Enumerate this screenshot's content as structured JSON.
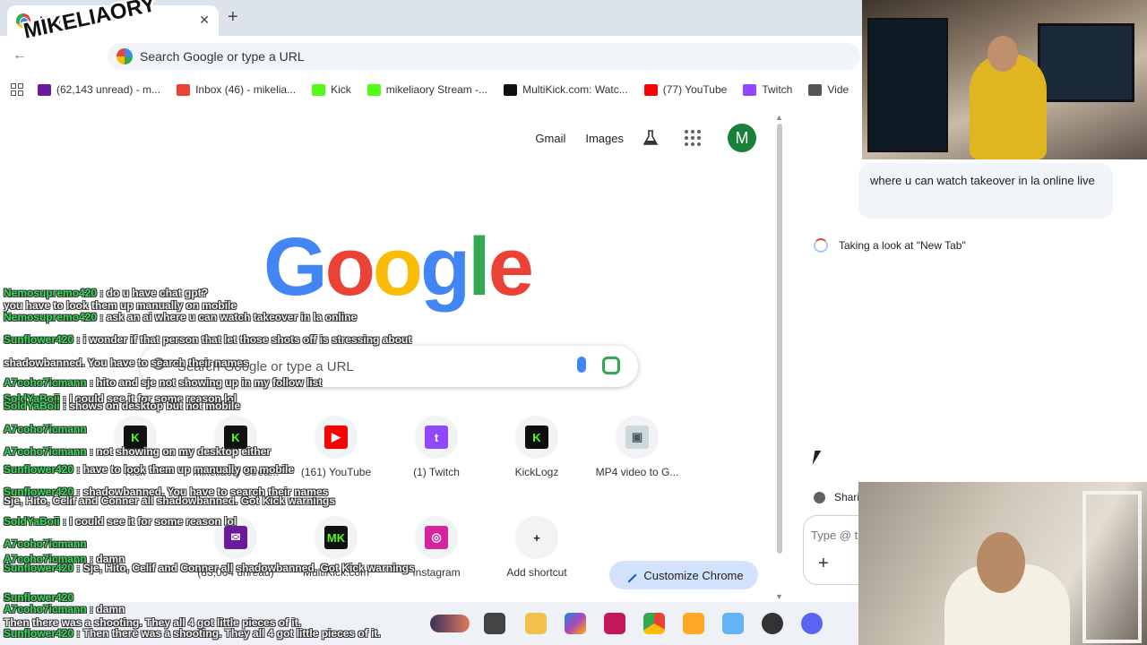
{
  "tab": {
    "title": "New Tab",
    "close": "✕",
    "new_tab": "+"
  },
  "toolbar": {
    "back": "←",
    "omnibox_placeholder": "Search Google or type a URL"
  },
  "overlay_brand": "MIKELIAORY",
  "bookmarks": [
    {
      "label": "(62,143 unread) - m...",
      "color": "#6a1b9a"
    },
    {
      "label": "Inbox (46) - mikelia...",
      "color": "#ea4335"
    },
    {
      "label": "Kick",
      "color": "#53fc18"
    },
    {
      "label": "mikeliaory Stream -...",
      "color": "#53fc18"
    },
    {
      "label": "MultiKick.com: Watc...",
      "color": "#111111"
    },
    {
      "label": "(77) YouTube",
      "color": "#ff0000"
    },
    {
      "label": "Twitch",
      "color": "#9146ff"
    },
    {
      "label": "Vide",
      "color": "#555555"
    }
  ],
  "ntp": {
    "links": {
      "gmail": "Gmail",
      "images": "Images"
    },
    "avatar_letter": "M",
    "logo_letters": [
      "G",
      "o",
      "o",
      "g",
      "l",
      "e"
    ],
    "search_placeholder": "Search Google or type a URL",
    "shortcuts": [
      {
        "label": "Kick",
        "glyph": "K",
        "bg": "#111111",
        "fg": "#53fc18"
      },
      {
        "label": "mikeliaory Strea...",
        "glyph": "K",
        "bg": "#111111",
        "fg": "#53fc18"
      },
      {
        "label": "(161) YouTube",
        "glyph": "▶",
        "bg": "#ff0000",
        "fg": "#ffffff"
      },
      {
        "label": "(1) Twitch",
        "glyph": "t",
        "bg": "#9146ff",
        "fg": "#ffffff"
      },
      {
        "label": "KickLogz",
        "glyph": "K",
        "bg": "#0f0f0f",
        "fg": "#53fc18"
      },
      {
        "label": "MP4 video to G...",
        "glyph": "▣",
        "bg": "#cfd8dc",
        "fg": "#455a64"
      },
      {
        "label": "(83,064 unread)",
        "glyph": "✉",
        "bg": "#6a1b9a",
        "fg": "#ffffff"
      },
      {
        "label": "MultiKick.com",
        "glyph": "MK",
        "bg": "#111111",
        "fg": "#53fc18"
      },
      {
        "label": "Instagram",
        "glyph": "◎",
        "bg": "#d6249f",
        "fg": "#ffffff"
      },
      {
        "label": "Add shortcut",
        "glyph": "+",
        "bg": "#f1f3f4",
        "fg": "#1f1f1f"
      }
    ],
    "customize_label": "Customize Chrome"
  },
  "sidepanel": {
    "user_message": "where u can watch takeover in la online live",
    "status": "Taking a look at \"New Tab\"",
    "share_label": "Shari",
    "input_placeholder": "Type @ t",
    "plus": "+"
  },
  "chat": [
    {
      "user": "Nemosupremo420",
      "text": ": do u have chat gpt?"
    },
    {
      "user": "",
      "text": "you have to look them up manually on mobile"
    },
    {
      "user": "Nemosupremo420",
      "text": ": ask an ai where u can watch takeover in la online"
    },
    {
      "user": "Sunflower420",
      "text": ": i wonder if that person that let those shots off is stressing about"
    },
    {
      "user": "",
      "text": "shadowbanned. You have to search their names"
    },
    {
      "user": "A7coho7icmann",
      "text": ": hito and sje not showing up in my follow list"
    },
    {
      "user": "SoldYaBoii",
      "text": ": I could see it for some reason lol"
    },
    {
      "user": "SoldYaBoii",
      "text": ": shows on desktop but not mobile"
    },
    {
      "user": "A7coho7icmann",
      "text": ""
    },
    {
      "user": "A7coho7icmann",
      "text": ": not showing on my desktop either"
    },
    {
      "user": "Sunflower420",
      "text": ": have to look them up manually on mobile"
    },
    {
      "user": "Sunflower420",
      "text": ": shadowbanned. You have to search their names"
    },
    {
      "user": "",
      "text": "Sje, Hito, Celif and Conner all shadowbanned. Got Kick warnings"
    },
    {
      "user": "SoldYaBoii",
      "text": ": I could see it for some reason lol"
    },
    {
      "user": "A7coho7icmann",
      "text": ""
    },
    {
      "user": "A7coho7icmann",
      "text": ": damn"
    },
    {
      "user": "Sunflower420",
      "text": ": Sje, Hito, Celif and Conner all shadowbanned. Got Kick warnings"
    },
    {
      "user": "Sunflower420",
      "text": ""
    },
    {
      "user": "A7coho7icmann",
      "text": ": damn"
    },
    {
      "user": "",
      "text": "Then there was a shooting. They all 4 got little pieces of it."
    },
    {
      "user": "Sunflower420",
      "text": ": Then there was a shooting. They all 4 got little pieces of it."
    }
  ]
}
